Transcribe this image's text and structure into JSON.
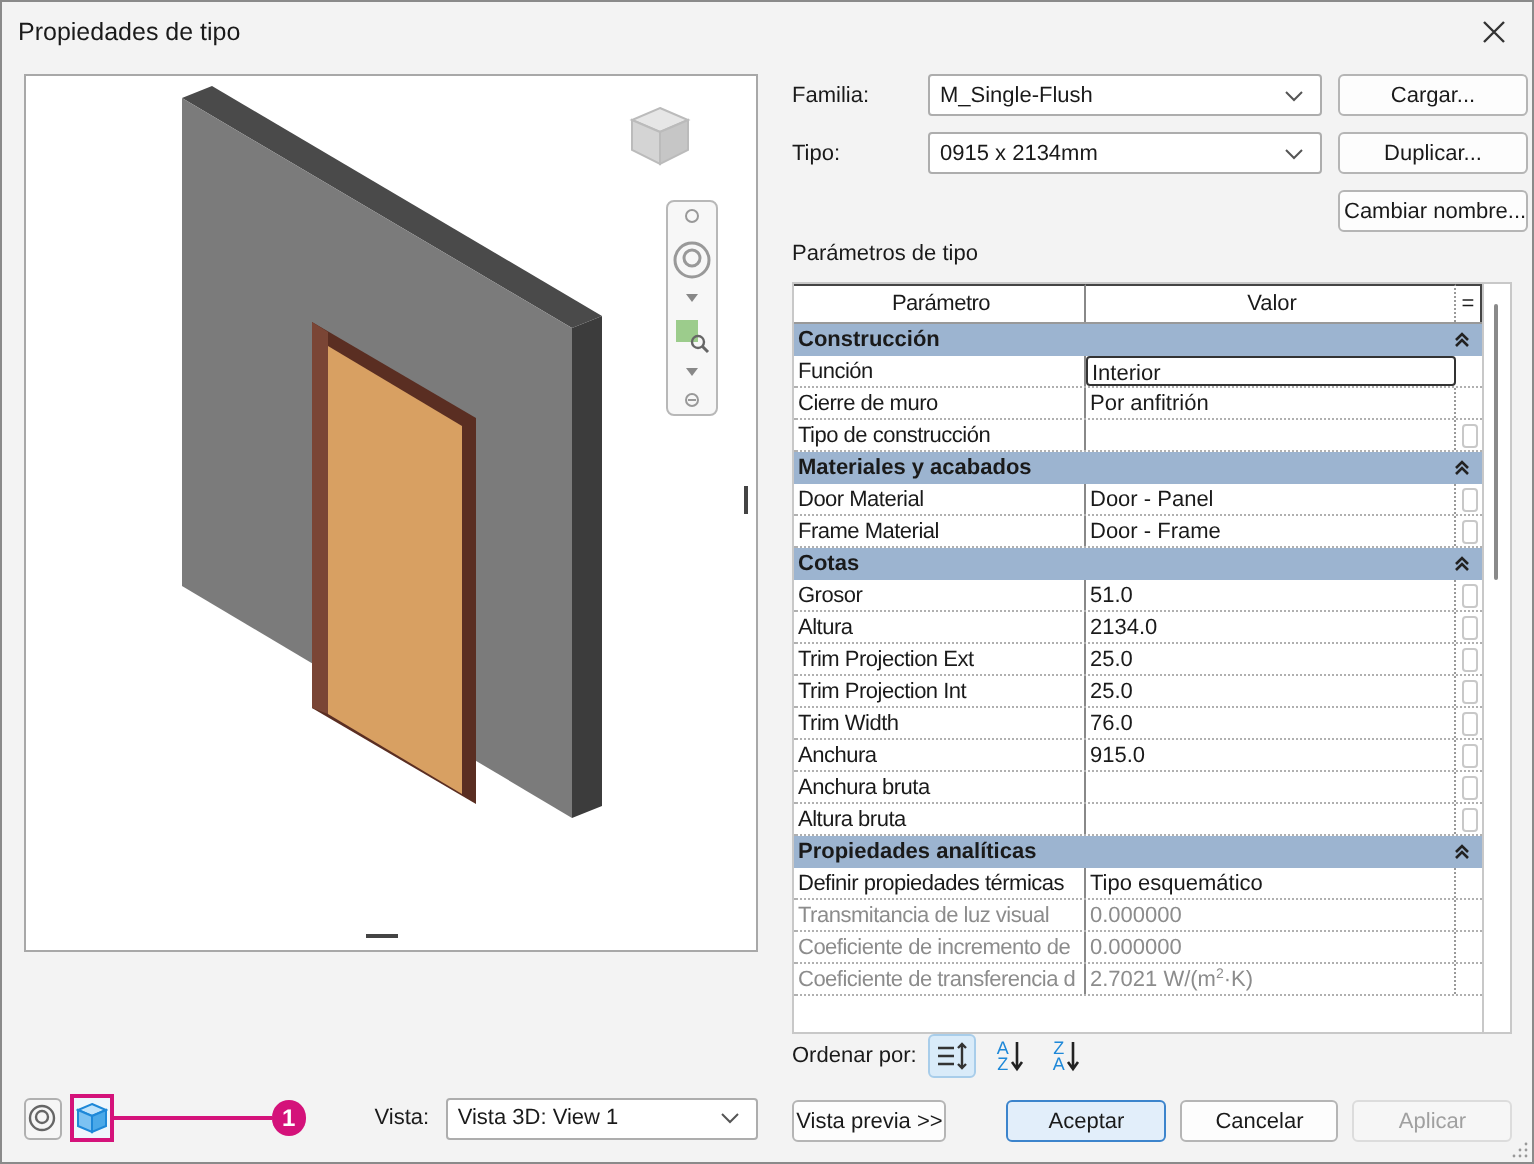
{
  "window": {
    "title": "Propiedades de tipo"
  },
  "familia": {
    "label": "Familia:",
    "value": "M_Single-Flush"
  },
  "tipo": {
    "label": "Tipo:",
    "value": "0915 x 2134mm"
  },
  "side_buttons": [
    "Cargar...",
    "Duplicar...",
    "Cambiar nombre..."
  ],
  "parameters": {
    "title": "Parámetros de tipo",
    "columns": [
      "Parámetro",
      "Valor",
      "="
    ],
    "groups": [
      {
        "name": "Construcción",
        "expanded": true,
        "rows": [
          {
            "name": "Función",
            "value": "Interior",
            "selected": true,
            "disabled": false,
            "linkable": false
          },
          {
            "name": "Cierre de muro",
            "value": "Por anfitrión",
            "selected": false,
            "disabled": false,
            "linkable": false
          },
          {
            "name": "Tipo de construcción",
            "selected": false,
            "disabled": false,
            "linkable": true
          }
        ]
      },
      {
        "name": "Materiales y acabados",
        "expanded": true,
        "rows": [
          {
            "name": "Door Material",
            "value": "Door - Panel",
            "selected": false,
            "disabled": false,
            "linkable": true
          },
          {
            "name": "Frame Material",
            "value": "Door - Frame",
            "selected": false,
            "disabled": false,
            "linkable": true
          }
        ]
      },
      {
        "name": "Cotas",
        "expanded": true,
        "rows": [
          {
            "name": "Grosor",
            "value": "51.0",
            "selected": false,
            "disabled": false,
            "linkable": true
          },
          {
            "name": "Altura",
            "value": "2134.0",
            "selected": false,
            "disabled": false,
            "linkable": true
          },
          {
            "name": "Trim Projection Ext",
            "value": "25.0",
            "selected": false,
            "disabled": false,
            "linkable": true
          },
          {
            "name": "Trim Projection Int",
            "value": "25.0",
            "selected": false,
            "disabled": false,
            "linkable": true
          },
          {
            "name": "Trim Width",
            "value": "76.0",
            "selected": false,
            "disabled": false,
            "linkable": true
          },
          {
            "name": "Anchura",
            "value": "915.0",
            "selected": false,
            "disabled": false,
            "linkable": true
          },
          {
            "name": "Anchura bruta",
            "selected": false,
            "disabled": false,
            "linkable": true
          },
          {
            "name": "Altura bruta",
            "selected": false,
            "disabled": false,
            "linkable": true
          }
        ]
      },
      {
        "name": "Propiedades analíticas",
        "expanded": true,
        "rows": [
          {
            "name": "Definir propiedades térmicas",
            "value": "Tipo esquemático",
            "selected": false,
            "disabled": false,
            "linkable": false
          },
          {
            "name": "Transmitancia de luz visual",
            "value": "0.000000",
            "selected": false,
            "disabled": true,
            "linkable": false
          },
          {
            "name": "Coeficiente de incremento de",
            "value": "0.000000",
            "selected": false,
            "disabled": true,
            "linkable": false
          },
          {
            "name": "Coeficiente de transferencia d",
            "value": "2.7021 W/(m$^{2}$·K)",
            "selected": false,
            "disabled": true,
            "linkable": false
          }
        ]
      }
    ]
  },
  "sort": {
    "label": "Ordenar por:",
    "options": [
      {
        "kind": "group",
        "selected": true
      },
      {
        "kind": "alpha",
        "top": "A",
        "bottom": "Z",
        "selected": false
      },
      {
        "kind": "alpha",
        "top": "Z",
        "bottom": "A",
        "selected": false
      }
    ]
  },
  "callout": {
    "label": "1"
  },
  "vista": {
    "label": "Vista:",
    "value": "Vista 3D: View 1"
  },
  "buttons": [
    {
      "label": "Vista previa >>",
      "kind": "normal",
      "disabled": false
    },
    {
      "label": "Aceptar",
      "kind": "default",
      "disabled": false
    },
    {
      "label": "Cancelar",
      "kind": "normal",
      "disabled": false
    },
    {
      "label": "Aplicar",
      "kind": "normal",
      "disabled": true
    }
  ]
}
